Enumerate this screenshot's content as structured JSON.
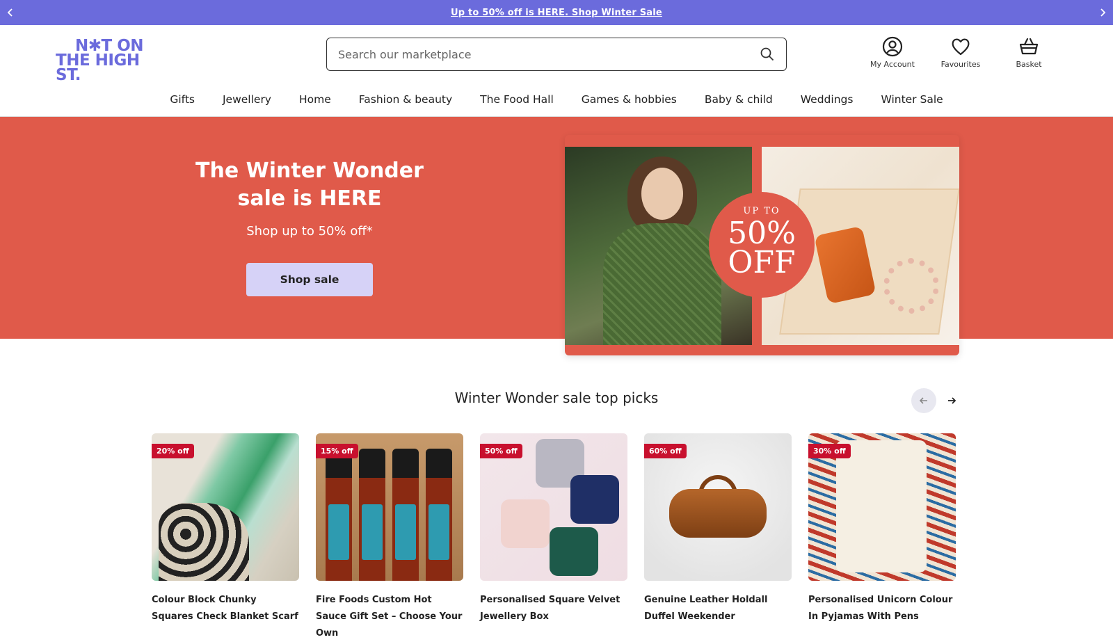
{
  "promo": {
    "text": "Up to 50% off is HERE. Shop Winter Sale"
  },
  "logo": {
    "line1": "N✱T ON",
    "line2": "THE HIGH ST."
  },
  "search": {
    "placeholder": "Search our marketplace"
  },
  "header_actions": {
    "account": "My Account",
    "favourites": "Favourites",
    "basket": "Basket"
  },
  "nav": [
    "Gifts",
    "Jewellery",
    "Home",
    "Fashion & beauty",
    "The Food Hall",
    "Games & hobbies",
    "Baby & child",
    "Weddings",
    "Winter Sale"
  ],
  "hero": {
    "title": "The Winter Wonder sale is HERE",
    "subtitle": "Shop up to 50% off*",
    "button": "Shop sale",
    "badge_upto": "UP TO",
    "badge_pct": "50%",
    "badge_off": "OFF"
  },
  "picks": {
    "title": "Winter Wonder sale top picks",
    "products": [
      {
        "discount": "20% off",
        "name": "Colour Block Chunky Squares Check Blanket Scarf"
      },
      {
        "discount": "15% off",
        "name": "Fire Foods Custom Hot Sauce Gift Set – Choose Your Own"
      },
      {
        "discount": "50% off",
        "name": "Personalised Square Velvet Jewellery Box"
      },
      {
        "discount": "60% off",
        "name": "Genuine Leather Holdall Duffel Weekender"
      },
      {
        "discount": "30% off",
        "name": "Personalised Unicorn Colour In Pyjamas With Pens"
      }
    ]
  },
  "colors": {
    "brand": "#6b6bdc",
    "hero_bg": "#e05a4a",
    "sale_tag": "#c8102e",
    "button_bg": "#d6d2f7"
  }
}
